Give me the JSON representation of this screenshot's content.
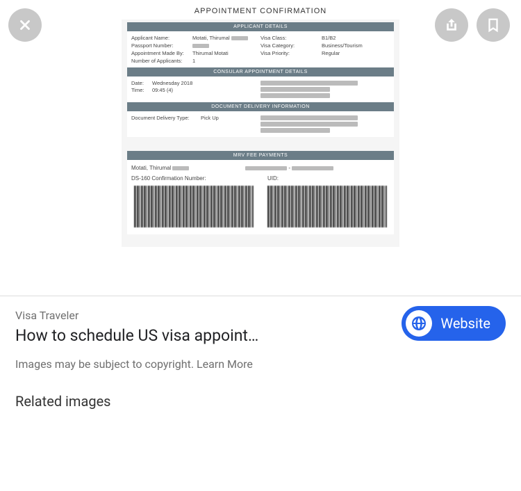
{
  "doc": {
    "title": "APPOINTMENT CONFIRMATION",
    "sections": {
      "applicant": {
        "header": "APPLICANT DETAILS",
        "applicant_name_label": "Applicant Name:",
        "applicant_name_value": "Motati, Thirumal",
        "passport_number_label": "Passport Number:",
        "appointment_made_by_label": "Appointment Made By:",
        "appointment_made_by_value": "Thirumal Motati",
        "number_of_applicants_label": "Number of Applicants:",
        "number_of_applicants_value": "1",
        "visa_class_label": "Visa Class:",
        "visa_class_value": "B1/B2",
        "visa_category_label": "Visa Category:",
        "visa_category_value": "Business/Tourism",
        "visa_priority_label": "Visa Priority:",
        "visa_priority_value": "Regular"
      },
      "consular": {
        "header": "CONSULAR APPOINTMENT DETAILS",
        "date_label": "Date:",
        "date_value": "Wednesday        2018",
        "time_label": "Time:",
        "time_value": "09:45 (4)"
      },
      "delivery": {
        "header": "DOCUMENT DELIVERY INFORMATION",
        "doc_delivery_type_label": "Document Delivery Type:",
        "doc_delivery_type_value": "Pick Up"
      },
      "payments": {
        "header": "MRV FEE PAYMENTS",
        "name_value": "Motati, Thirumal",
        "ds160_label": "DS-160 Confirmation Number:",
        "uid_label": "UID:"
      }
    }
  },
  "result": {
    "source": "Visa Traveler",
    "title": "How to schedule US visa appoint…",
    "website_label": "Website",
    "copyright_text": "Images may be subject to copyright. ",
    "learn_more": "Learn More",
    "related_heading": "Related images"
  }
}
